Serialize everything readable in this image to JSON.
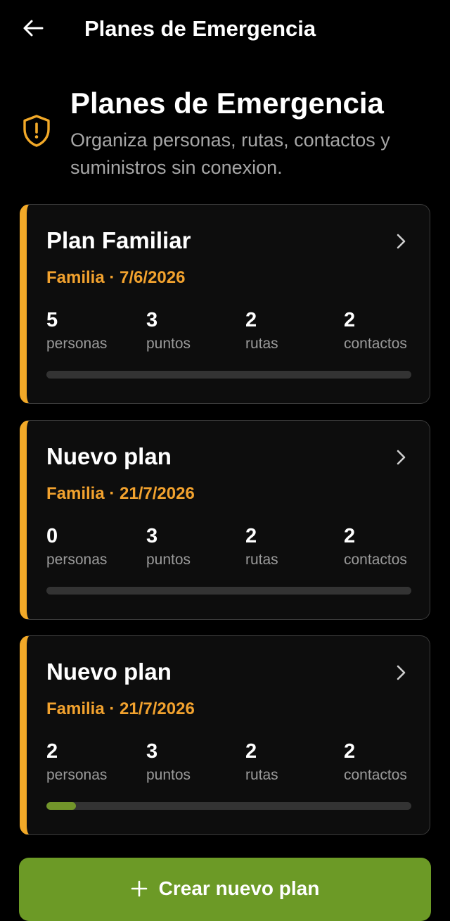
{
  "appbar": {
    "title": "Planes de Emergencia"
  },
  "hero": {
    "title": "Planes de Emergencia",
    "subtitle": "Organiza personas, rutas, contactos y suministros sin conexion.",
    "icon": "shield-alert-icon"
  },
  "colors": {
    "accent": "#f2a928",
    "primary_button": "#6c9a26",
    "progress_fill": "#72952a",
    "background": "#000000"
  },
  "plans": [
    {
      "title": "Plan Familiar",
      "subtitle": "Familia · 7/6/2026",
      "stats": [
        {
          "value": "5",
          "label": "personas"
        },
        {
          "value": "3",
          "label": "puntos"
        },
        {
          "value": "2",
          "label": "rutas"
        },
        {
          "value": "2",
          "label": "contactos"
        }
      ],
      "progress": 0
    },
    {
      "title": "Nuevo plan",
      "subtitle": "Familia · 21/7/2026",
      "stats": [
        {
          "value": "0",
          "label": "personas"
        },
        {
          "value": "3",
          "label": "puntos"
        },
        {
          "value": "2",
          "label": "rutas"
        },
        {
          "value": "2",
          "label": "contactos"
        }
      ],
      "progress": 0
    },
    {
      "title": "Nuevo plan",
      "subtitle": "Familia · 21/7/2026",
      "stats": [
        {
          "value": "2",
          "label": "personas"
        },
        {
          "value": "3",
          "label": "puntos"
        },
        {
          "value": "2",
          "label": "rutas"
        },
        {
          "value": "2",
          "label": "contactos"
        }
      ],
      "progress": 0.08
    }
  ],
  "create_button": {
    "label": "Crear nuevo plan",
    "icon": "plus-icon"
  }
}
